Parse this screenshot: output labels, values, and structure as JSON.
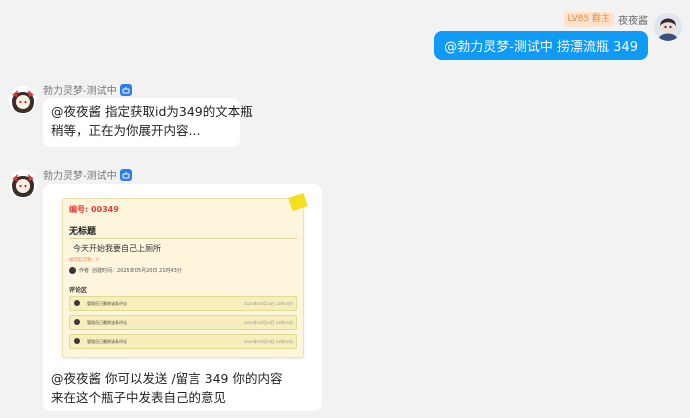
{
  "outgoing": {
    "badge": "LV85 群主",
    "sender": "夜夜酱",
    "message": "@勃力灵梦-测试中 捞漂流瓶 349"
  },
  "bot": {
    "name": "勃力灵梦-测试中"
  },
  "reply1": {
    "line1": "@夜夜酱 指定获取id为349的文本瓶",
    "line2": "稍等，正在为你展开内容..."
  },
  "card": {
    "number": "编号: 00349",
    "title": "无标题",
    "body": "今天开始我要自己上厕所",
    "pick_count": "被捞起次数：9",
    "author_label": "作者",
    "created": "创建时间：2025年05月20日 21时43分",
    "comments_header": "评论区",
    "comments": [
      {
        "text": "管理员已删除该条评论",
        "time": "2025年05月20日 21时45分"
      },
      {
        "text": "管理员已删除该条评论",
        "time": "2025年05月20日 22时01分"
      },
      {
        "text": "管理员已删除该条评论",
        "time": "2025年05月20日 22时05分"
      }
    ]
  },
  "reply2": {
    "line1": "@夜夜酱 你可以发送 /留言 349 你的内容",
    "line2": "来在这个瓶子中发表自己的意见"
  }
}
